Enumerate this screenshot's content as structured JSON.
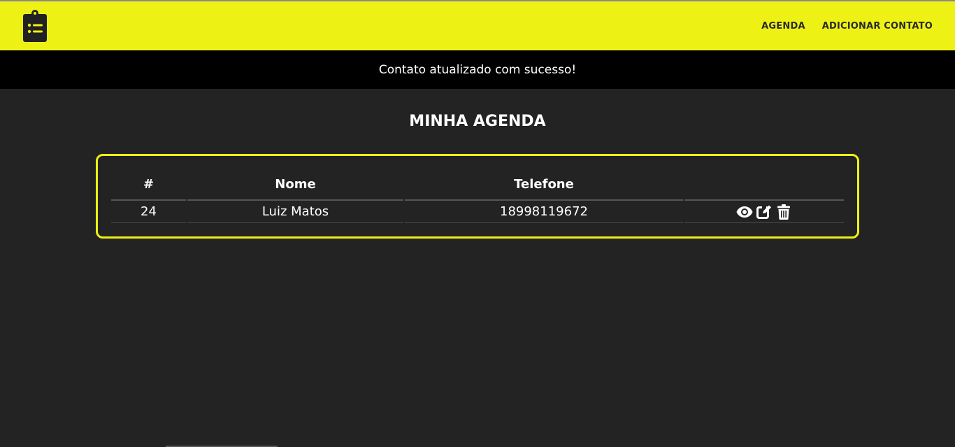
{
  "navbar": {
    "logo_icon": "clipboard-list-icon",
    "links": [
      {
        "label": "AGENDA"
      },
      {
        "label": "ADICIONAR CONTATO"
      }
    ],
    "background": "#eef214"
  },
  "alert": {
    "message": "Contato atualizado com sucesso!"
  },
  "main": {
    "title": "MINHA AGENDA",
    "table": {
      "headers": [
        "#",
        "Nome",
        "Telefone",
        ""
      ],
      "rows": [
        {
          "id": "24",
          "nome": "Luiz Matos",
          "telefone": "18998119672",
          "actions": [
            "eye-icon",
            "edit-icon",
            "trash-icon"
          ]
        }
      ]
    }
  },
  "colors": {
    "accent": "#eef214",
    "background": "#232323",
    "alert_background": "#000000"
  }
}
